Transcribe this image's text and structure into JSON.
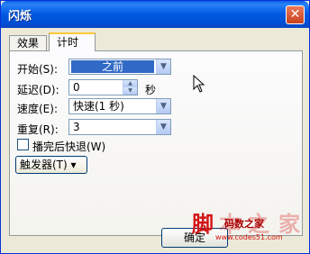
{
  "window": {
    "title": "闪烁",
    "close_label": "✕"
  },
  "tabs": [
    {
      "label": "效果"
    },
    {
      "label": "计时"
    }
  ],
  "timing": {
    "start": {
      "label": "开始(S):",
      "value": "之前"
    },
    "delay": {
      "label": "延迟(D):",
      "value": "0",
      "unit": "秒"
    },
    "speed": {
      "label": "速度(E):",
      "value": "快速(1 秒)"
    },
    "repeat": {
      "label": "重复(R):",
      "value": "3"
    },
    "rewind": {
      "label": "播完后快退(W)",
      "checked": false
    },
    "trigger_label": "触发器(T) ▾"
  },
  "footer": {
    "ok_label": "确定"
  },
  "watermark": {
    "glyphs": [
      "脚",
      "本",
      "之",
      "家"
    ],
    "name": "码数之家",
    "url": "www.codes51.com"
  },
  "colors": {
    "titlebar": "#0058e0",
    "selection": "#316ac5",
    "watermark": "#d21414"
  }
}
